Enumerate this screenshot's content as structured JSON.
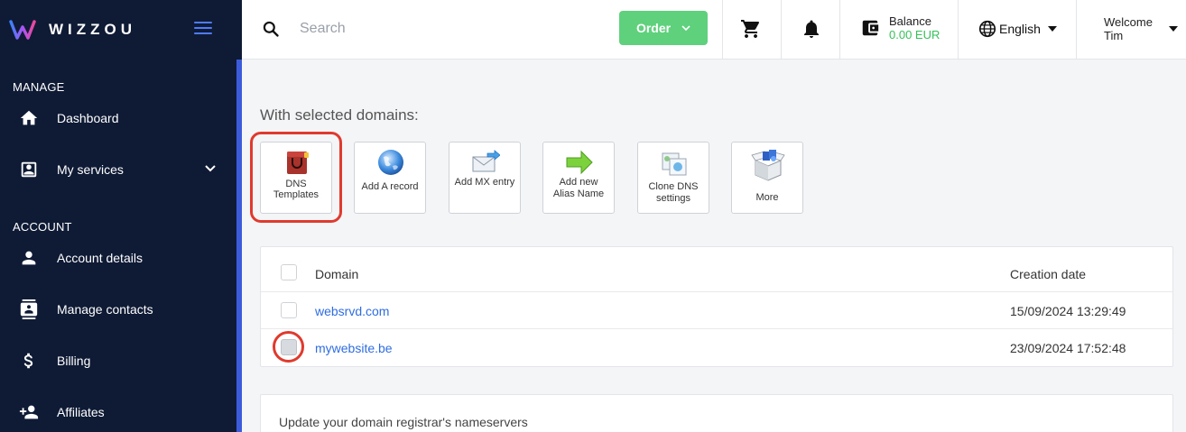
{
  "sidebar": {
    "logo_text": "WIZZOU",
    "sections": [
      "MANAGE",
      "ACCOUNT"
    ],
    "items": [
      {
        "label": "Dashboard",
        "icon": "home-icon"
      },
      {
        "label": "My services",
        "icon": "id-card-icon"
      },
      {
        "label": "Account details",
        "icon": "person-icon"
      },
      {
        "label": "Manage contacts",
        "icon": "contacts-icon"
      },
      {
        "label": "Billing",
        "icon": "dollar-icon"
      },
      {
        "label": "Affiliates",
        "icon": "person-add-icon"
      }
    ]
  },
  "topbar": {
    "search_placeholder": "Search",
    "order_label": "Order",
    "balance_label": "Balance",
    "balance_value": "0.00 EUR",
    "language": "English",
    "welcome": "Welcome",
    "user": "Tim"
  },
  "actions": {
    "title": "With selected domains:",
    "buttons": [
      {
        "label1": "DNS",
        "label2": "Templates",
        "icon": "dns-templates-icon"
      },
      {
        "label1": "Add A record",
        "label2": "",
        "icon": "globe-icon"
      },
      {
        "label1": "Add MX entry",
        "label2": "",
        "icon": "mail-icon"
      },
      {
        "label1": "Add new",
        "label2": "Alias Name",
        "icon": "arrow-icon"
      },
      {
        "label1": "Clone DNS",
        "label2": "settings",
        "icon": "clone-icon"
      },
      {
        "label1": "More",
        "label2": "",
        "icon": "box-icon"
      }
    ]
  },
  "table": {
    "headers": [
      "Domain",
      "Creation date"
    ],
    "rows": [
      {
        "domain": "websrvd.com",
        "date": "15/09/2024 13:29:49",
        "checked": false
      },
      {
        "domain": "mywebsite.be",
        "date": "23/09/2024 17:52:48",
        "checked": true
      }
    ]
  },
  "nameservers": {
    "title": "Update your domain registrar's nameservers"
  },
  "colors": {
    "sidebar_bg": "#0f1b35",
    "accent_blue": "#4f7cff",
    "order_green": "#5fd07c",
    "balance_green": "#36c05a",
    "highlight_red": "#e03a2e",
    "link_blue": "#2f6de1"
  }
}
